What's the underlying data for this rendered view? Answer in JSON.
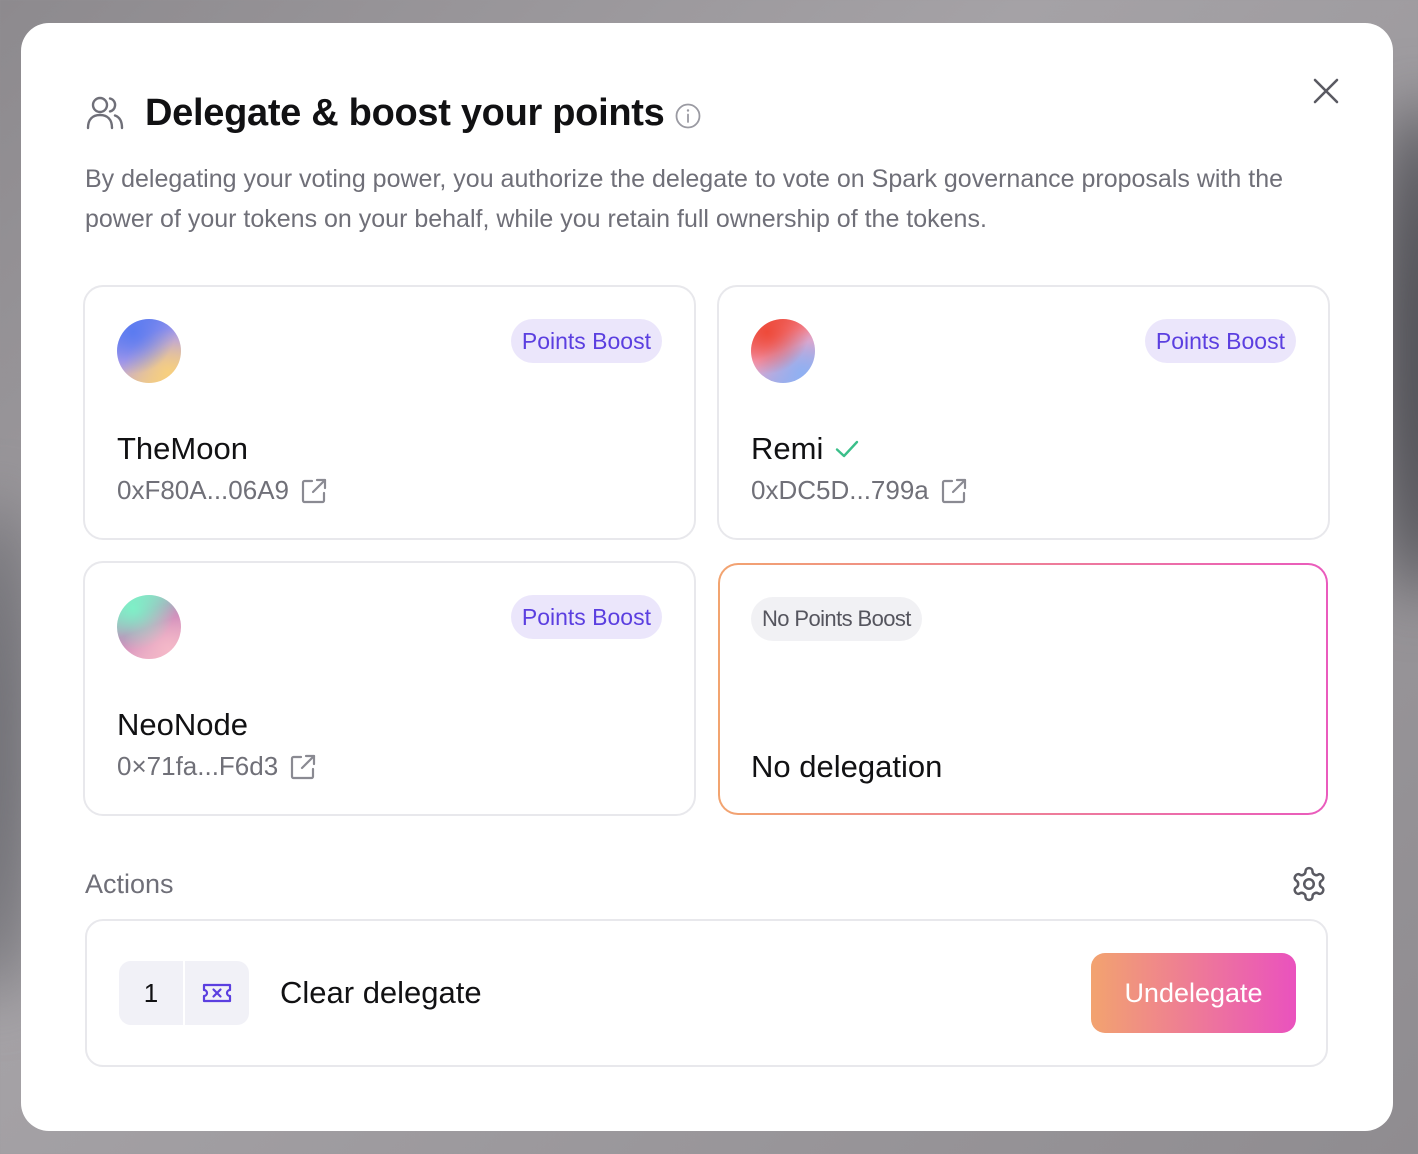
{
  "modal": {
    "title": "Delegate & boost your points",
    "description": "By delegating your voting power, you authorize the delegate to vote on Spark governance proposals with the power of your tokens on your behalf, while you retain full ownership of the tokens.",
    "close_icon": "close-icon",
    "info_icon": "info-icon",
    "header_icon": "users-icon"
  },
  "delegates": [
    {
      "name": "TheMoon",
      "address": "0xF80A...06A9",
      "badge": "Points Boost",
      "verified": false,
      "avatar_colors": [
        "#5b7bf0",
        "#b39ee8",
        "#f7cf7e"
      ]
    },
    {
      "name": "Remi",
      "address": "0xDC5D...799a",
      "badge": "Points Boost",
      "verified": true,
      "avatar_colors": [
        "#ee4a3a",
        "#f2a3c2",
        "#8fb0f2"
      ]
    },
    {
      "name": "NeoNode",
      "address": "0×71fa...F6d3",
      "badge": "Points Boost",
      "verified": false,
      "avatar_colors": [
        "#7ef0c7",
        "#c884b9",
        "#f4b8c8"
      ]
    }
  ],
  "no_delegation": {
    "badge": "No Points Boost",
    "label": "No delegation",
    "selected": true
  },
  "actions": {
    "label": "Actions",
    "settings_icon": "gear-icon",
    "items": [
      {
        "step": "1",
        "icon": "ticket-x-icon",
        "label": "Clear delegate",
        "button": "Undelegate"
      }
    ]
  },
  "colors": {
    "badge_text": "#5b3fe0",
    "badge_bg": "#ebe6fb",
    "gradient_start": "#f2a36f",
    "gradient_end": "#ea52be",
    "verified": "#3bbf8a"
  }
}
